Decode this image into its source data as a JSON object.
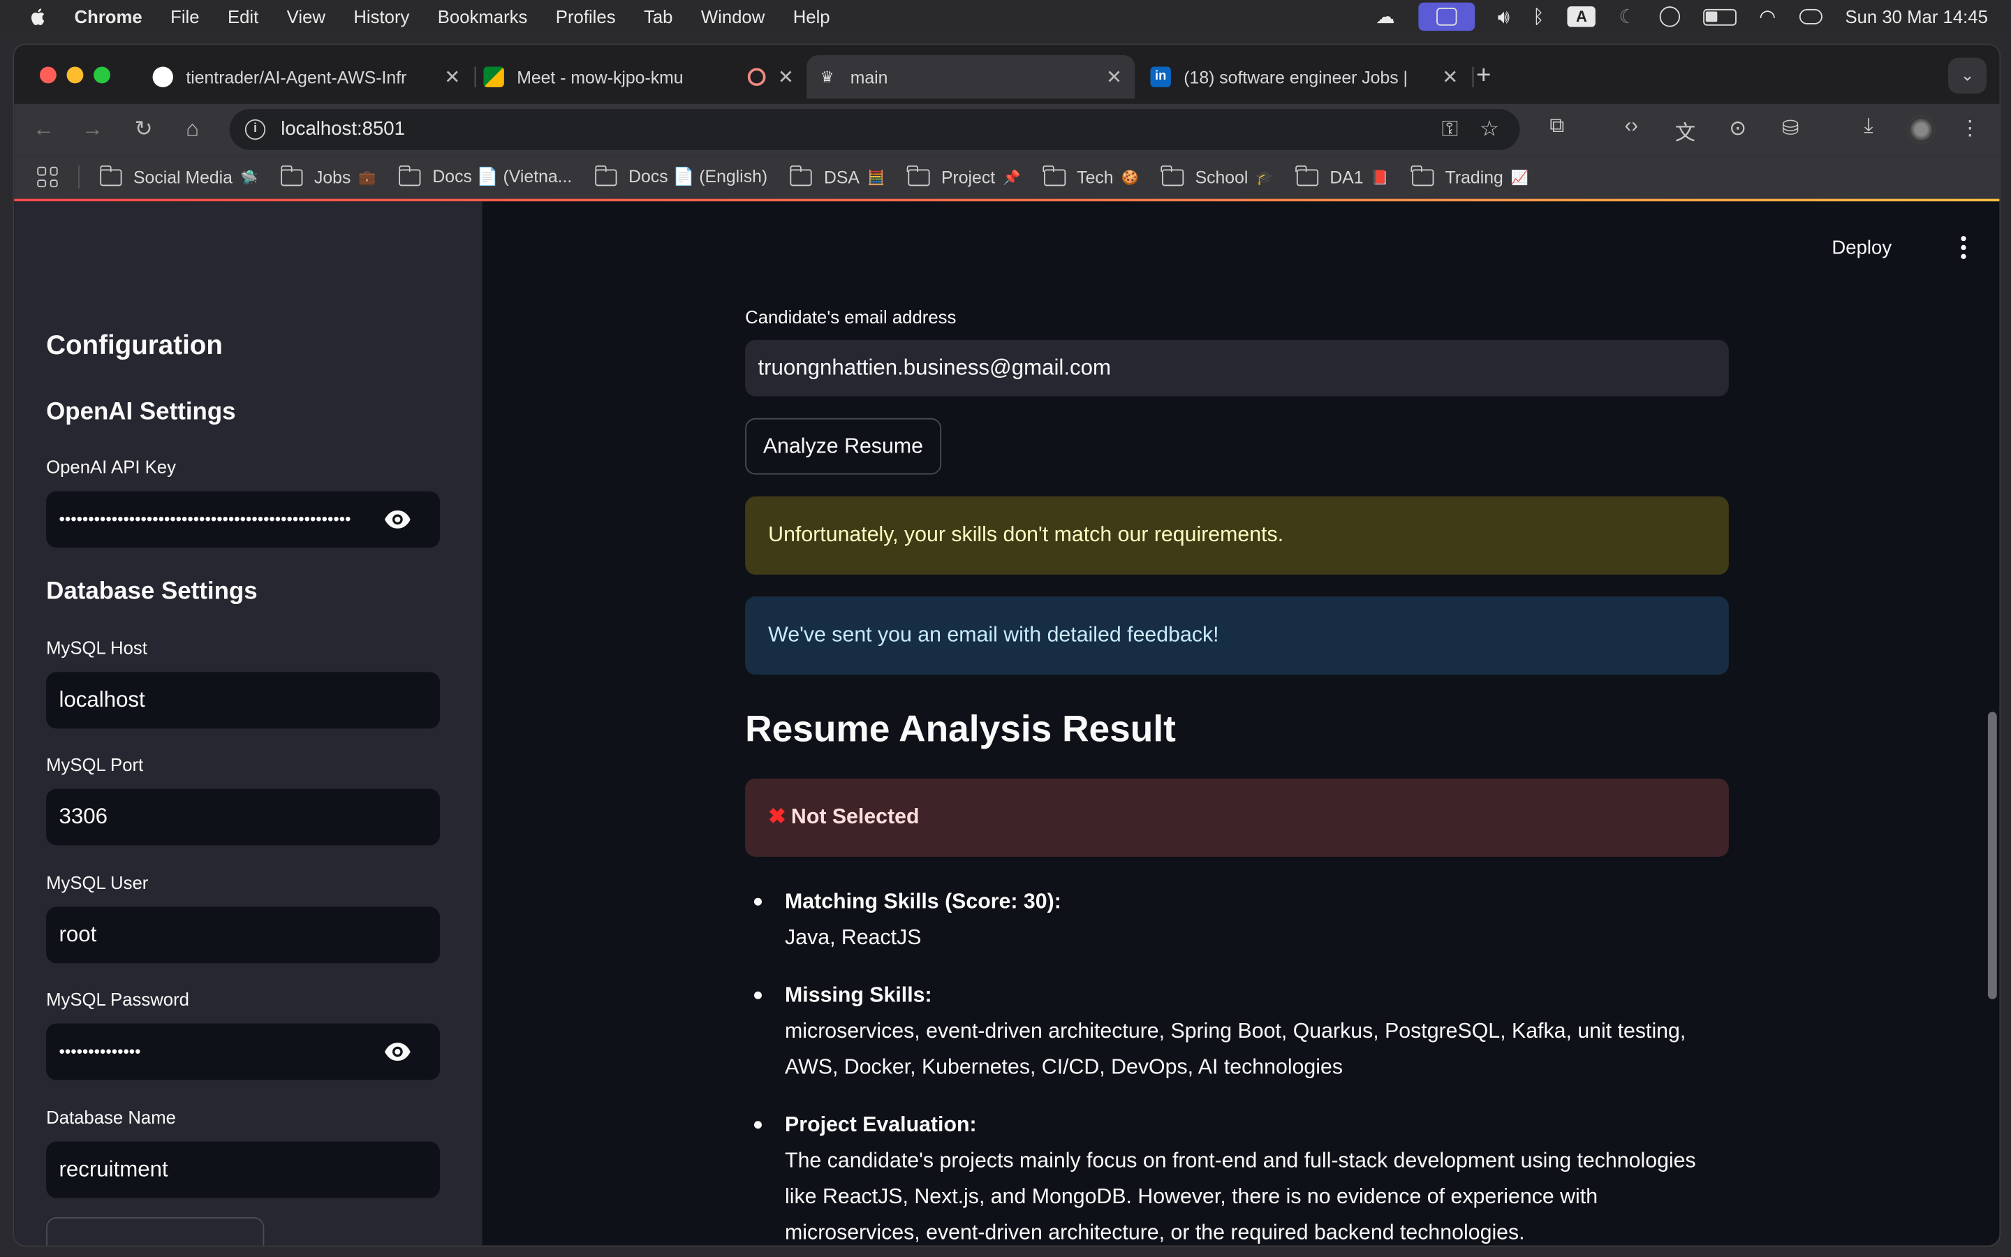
{
  "menubar": {
    "app_name": "Chrome",
    "items": [
      "File",
      "Edit",
      "View",
      "History",
      "Bookmarks",
      "Profiles",
      "Tab",
      "Window",
      "Help"
    ],
    "keyboard_indicator": "A",
    "clock": "Sun 30 Mar  14:45"
  },
  "tabs": [
    {
      "title": "tientrader/AI-Agent-AWS-Infr",
      "icon": "github-icon"
    },
    {
      "title": "Meet - mow-kjpo-kmu",
      "icon": "google-meet-icon",
      "recording": true
    },
    {
      "title": "main",
      "icon": "streamlit-icon",
      "active": true
    },
    {
      "title": "(18) software engineer Jobs |",
      "icon": "linkedin-icon"
    }
  ],
  "address_bar": {
    "url": "localhost:8501"
  },
  "bookmarks": [
    {
      "label": "Social Media",
      "emoji": "🛸"
    },
    {
      "label": "Jobs",
      "emoji": "💼"
    },
    {
      "label": "Docs 📄 (Vietna...",
      "emoji": ""
    },
    {
      "label": "Docs 📄 (English)",
      "emoji": ""
    },
    {
      "label": "DSA",
      "emoji": "🧮"
    },
    {
      "label": "Project",
      "emoji": "📌"
    },
    {
      "label": "Tech",
      "emoji": "🍪"
    },
    {
      "label": "School",
      "emoji": "🎓"
    },
    {
      "label": "DA1",
      "emoji": "📕"
    },
    {
      "label": "Trading",
      "emoji": "📈"
    }
  ],
  "sidebar": {
    "title": "Configuration",
    "openai_heading": "OpenAI Settings",
    "api_key_label": "OpenAI API Key",
    "api_key_value": "••••••••••••••••••••••••••••••••••••••••••••••••••",
    "db_heading": "Database Settings",
    "host_label": "MySQL Host",
    "host_value": "localhost",
    "port_label": "MySQL Port",
    "port_value": "3306",
    "user_label": "MySQL User",
    "user_value": "root",
    "password_label": "MySQL Password",
    "password_value": "••••••••••••••",
    "dbname_label": "Database Name",
    "dbname_value": "recruitment"
  },
  "header": {
    "deploy_label": "Deploy"
  },
  "main": {
    "email_label": "Candidate's email address",
    "email_value": "truongnhattien.business@gmail.com",
    "analyze_button": "Analyze Resume",
    "warning_text": "Unfortunately, your skills don't match our requirements.",
    "info_text": "We've sent you an email with detailed feedback!",
    "result_heading": "Resume Analysis Result",
    "status_text": "Not Selected",
    "results": [
      {
        "title": "Matching Skills (Score: 30):",
        "body": "Java, ReactJS"
      },
      {
        "title": "Missing Skills:",
        "body": "microservices, event-driven architecture, Spring Boot, Quarkus, PostgreSQL, Kafka, unit testing, AWS, Docker, Kubernetes, CI/CD, DevOps, AI technologies"
      },
      {
        "title": "Project Evaluation:",
        "body": "The candidate's projects mainly focus on front-end and full-stack development using technologies like ReactJS, Next.js, and MongoDB. However, there is no evidence of experience with microservices, event-driven architecture, or the required backend technologies."
      }
    ]
  },
  "colors": {
    "accent": "#ff4b4b",
    "warning_bg": "#3e3b16",
    "info_bg": "#172d43",
    "error_bg": "#3e2428"
  }
}
